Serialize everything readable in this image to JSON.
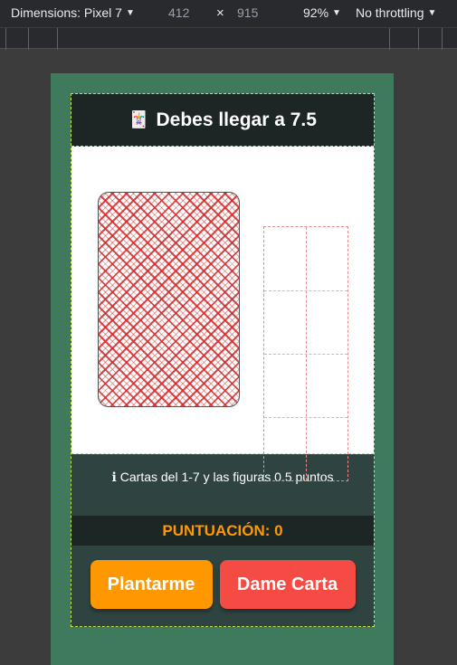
{
  "devtools": {
    "dimensions_label": "Dimensions: Pixel 7",
    "width": "412",
    "times": "×",
    "height": "915",
    "zoom": "92%",
    "throttling": "No throttling",
    "caret": "▼"
  },
  "game": {
    "title": "Debes llegar a 7.5",
    "title_icon": "🃏",
    "info_icon": "ℹ",
    "info_text": "Cartas del 1-7 y las figuras 0.5 puntos",
    "score_label": "PUNTUACIÓN: 0",
    "stand_label": "Plantarme",
    "draw_label": "Dame Carta"
  },
  "colors": {
    "table_green": "#3f7a5c",
    "stand_button": "#ff9800",
    "draw_button": "#f44c44",
    "score_text": "#ff9800"
  }
}
